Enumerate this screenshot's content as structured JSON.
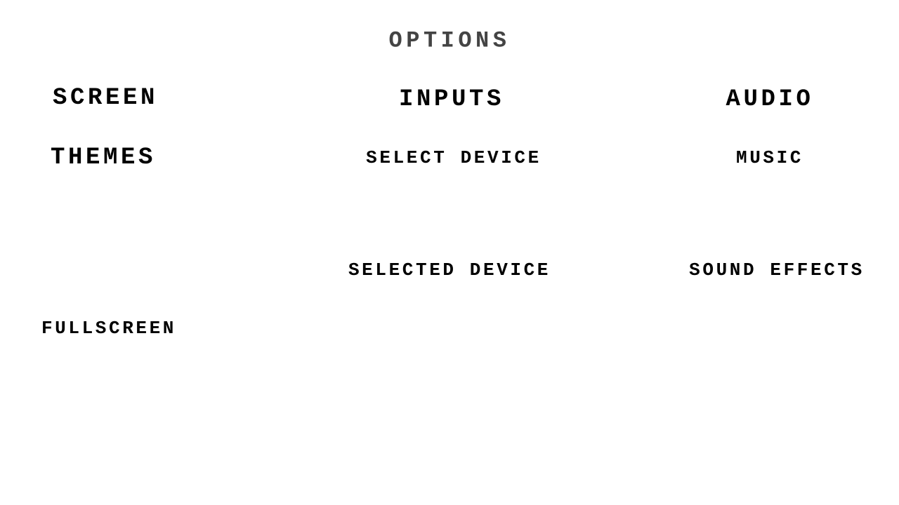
{
  "title": "OPTIONS",
  "screen": {
    "heading": "SCREEN",
    "themes": "THEMES",
    "fullscreen": "FULLSCREEN"
  },
  "inputs": {
    "heading": "INPUTS",
    "select_device": "SELECT DEVICE",
    "selected_device": "SELECTED DEVICE"
  },
  "audio": {
    "heading": "AUDIO",
    "music": "MUSIC",
    "sound_effects": "SOUND EFFECTS"
  }
}
